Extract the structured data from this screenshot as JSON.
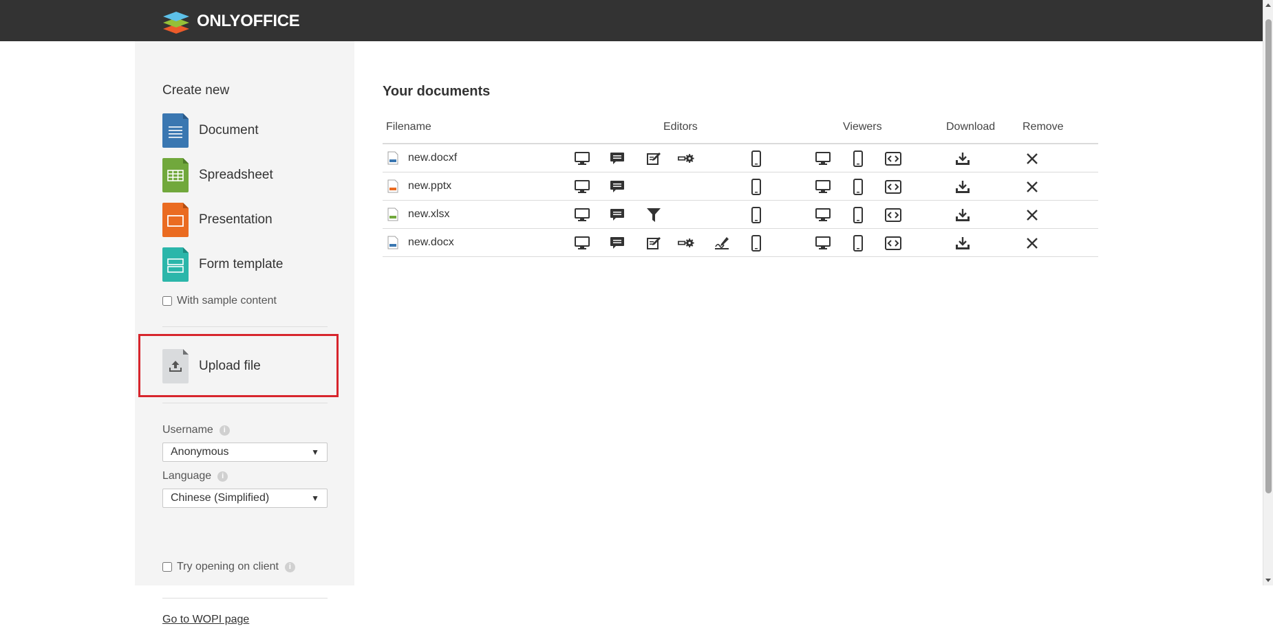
{
  "header": {
    "logo_text": "ONLYOFFICE"
  },
  "sidebar": {
    "create_title": "Create new",
    "create_items": [
      {
        "label": "Document",
        "color": "#3a77b1",
        "icon": "document-icon"
      },
      {
        "label": "Spreadsheet",
        "color": "#71a83c",
        "icon": "spreadsheet-icon"
      },
      {
        "label": "Presentation",
        "color": "#ea6b21",
        "icon": "presentation-icon"
      },
      {
        "label": "Form template",
        "color": "#2bb6aa",
        "icon": "form-template-icon"
      }
    ],
    "sample_content_label": "With sample content",
    "upload_label": "Upload file",
    "username_label": "Username",
    "username_value": "Anonymous",
    "language_label": "Language",
    "language_value": "Chinese (Simplified)",
    "try_client_label": "Try opening on client",
    "wopi_link": "Go to WOPI page"
  },
  "main": {
    "title": "Your documents",
    "columns": {
      "filename": "Filename",
      "editors": "Editors",
      "viewers": "Viewers",
      "download": "Download",
      "remove": "Remove"
    },
    "files": [
      {
        "name": "new.docxf",
        "type_color": "#3a77b1",
        "editors": [
          "desktop",
          "comment",
          "review",
          "fillform",
          null,
          "mobile"
        ]
      },
      {
        "name": "new.pptx",
        "type_color": "#ea6b21",
        "editors": [
          "desktop",
          "comment",
          null,
          null,
          null,
          "mobile"
        ]
      },
      {
        "name": "new.xlsx",
        "type_color": "#71a83c",
        "editors": [
          "desktop",
          "comment",
          "filter",
          null,
          null,
          "mobile"
        ]
      },
      {
        "name": "new.docx",
        "type_color": "#3a77b1",
        "editors": [
          "desktop",
          "comment",
          "review",
          "fillform",
          "sign",
          "mobile"
        ]
      }
    ]
  },
  "colors": {
    "topbar": "#333333",
    "sidebar": "#f4f4f4",
    "highlight": "#d7252c"
  }
}
